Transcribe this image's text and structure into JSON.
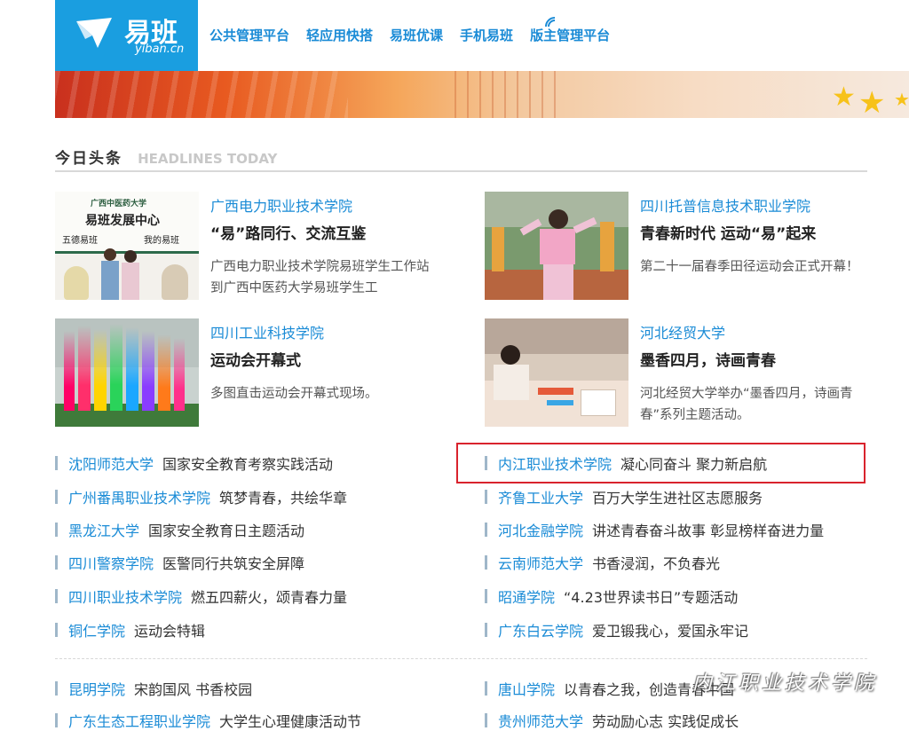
{
  "logo": {
    "cn": "易班",
    "en": "yiban.cn"
  },
  "top_nav": [
    "公共管理平台",
    "轻应用快搭",
    "易班优课",
    "手机易班",
    "版主管理平台"
  ],
  "section": {
    "title_cn": "今日头条",
    "title_en": "HEADLINES TODAY"
  },
  "photo_text": {
    "sign_line1": "广西中医药大学",
    "sign_line2": "易班发展中心",
    "sign_line3": "五德易班",
    "sign_line4": "我的易班"
  },
  "cards": [
    {
      "school": "广西电力职业技术学院",
      "title": "“易”路同行、交流互鉴",
      "desc": "广西电力职业技术学院易班学生工作站到广西中医药大学易班学生工"
    },
    {
      "school": "四川托普信息技术职业学院",
      "title": "青春新时代 运动“易”起来",
      "desc": "第二十一届春季田径运动会正式开幕！"
    },
    {
      "school": "四川工业科技学院",
      "title": "运动会开幕式",
      "desc": "多图直击运动会开幕式现场。"
    },
    {
      "school": "河北经贸大学",
      "title": "墨香四月，诗画青春",
      "desc": "河北经贸大学举办“墨香四月，诗画青春”系列主题活动。"
    }
  ],
  "left_list": [
    {
      "school": "沈阳师范大学",
      "title": "国家安全教育考察实践活动"
    },
    {
      "school": "广州番禺职业技术学院",
      "title": "筑梦青春，共绘华章"
    },
    {
      "school": "黑龙江大学",
      "title": "国家安全教育日主题活动"
    },
    {
      "school": "四川警察学院",
      "title": "医警同行共筑安全屏障"
    },
    {
      "school": "四川职业技术学院",
      "title": "燃五四薪火，颂青春力量"
    },
    {
      "school": "铜仁学院",
      "title": "运动会特辑"
    }
  ],
  "right_list": [
    {
      "school": "内江职业技术学院",
      "title": "凝心同奋斗 聚力新启航"
    },
    {
      "school": "齐鲁工业大学",
      "title": "百万大学生进社区志愿服务"
    },
    {
      "school": "河北金融学院",
      "title": "讲述青春奋斗故事 彰显榜样奋进力量"
    },
    {
      "school": "云南师范大学",
      "title": "书香浸润，不负春光"
    },
    {
      "school": "昭通学院",
      "title": "“4.23世界读书日”专题活动"
    },
    {
      "school": "广东白云学院",
      "title": "爱卫锻我心，爱国永牢记"
    }
  ],
  "bottom_left": [
    {
      "school": "昆明学院",
      "title": "宋韵国风 书香校园"
    },
    {
      "school": "广东生态工程职业学院",
      "title": "大学生心理健康活动节"
    }
  ],
  "bottom_right": [
    {
      "school": "唐山学院",
      "title": "以青春之我，创造青春中国"
    },
    {
      "school": "贵州师范大学",
      "title": "劳动励心志 实践促成长"
    }
  ],
  "watermark": "内江职业技术学院",
  "colors": {
    "brand": "#1a9ee0",
    "link": "#1a8bd6",
    "highlight_border": "#d9232d"
  }
}
